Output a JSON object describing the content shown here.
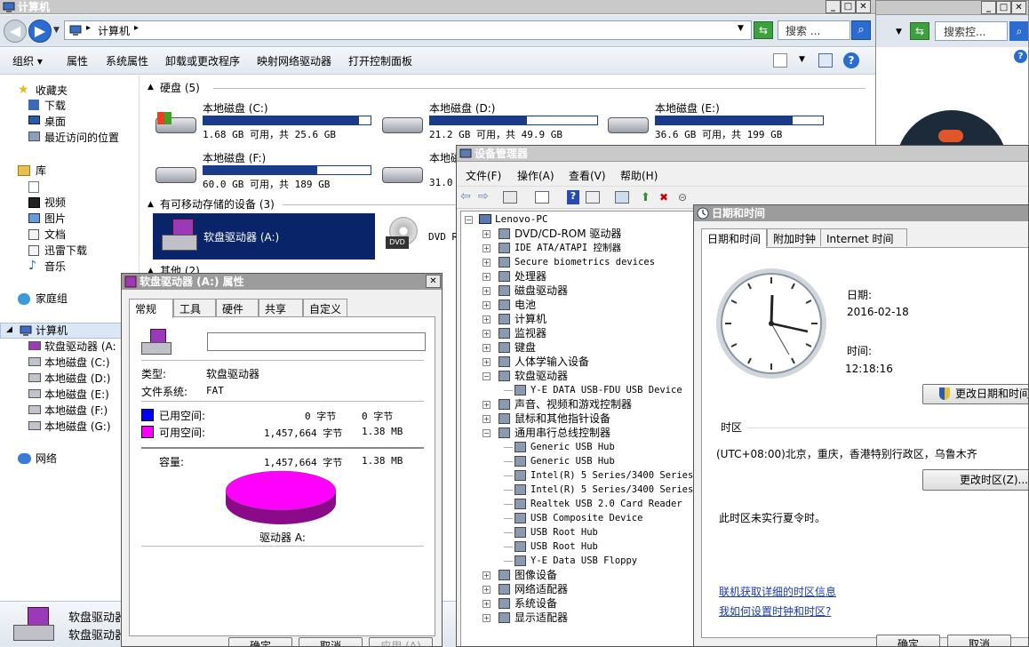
{
  "explorer": {
    "title": "计算机",
    "address_path": "计算机",
    "search_placeholder": "搜索 ...",
    "toolbar": [
      "组织 ▾",
      "属性",
      "系统属性",
      "卸载或更改程序",
      "映射网络驱动器",
      "打开控制面板"
    ],
    "nav": {
      "favorites": "收藏夹",
      "downloads": "下载",
      "desktop": "桌面",
      "recent": "最近访问的位置",
      "libraries": "库",
      "videos": "视频",
      "pictures": "图片",
      "documents": "文档",
      "xunlei": "迅雷下载",
      "music": "音乐",
      "homegroup": "家庭组",
      "computer": "计算机",
      "drives": [
        "软盘驱动器 (A:",
        "本地磁盘 (C:)",
        "本地磁盘 (D:)",
        "本地磁盘 (E:)",
        "本地磁盘 (F:)",
        "本地磁盘 (G:)"
      ],
      "network": "网络"
    },
    "hdd_group": "硬盘 (5)",
    "removable_group": "有可移动存储的设备 (3)",
    "other_group": "其他 (2)",
    "disks": [
      {
        "name": "本地磁盘 (C:)",
        "info": "1.68 GB 可用，共 25.6 GB",
        "used_pct": 93
      },
      {
        "name": "本地磁盘 (D:)",
        "info": "21.2 GB 可用，共 49.9 GB",
        "used_pct": 58
      },
      {
        "name": "本地磁盘 (E:)",
        "info": "36.6 GB 可用，共 199 GB",
        "used_pct": 82
      },
      {
        "name": "本地磁盘 (F:)",
        "info": "60.0 GB 可用，共 189 GB",
        "used_pct": 68
      },
      {
        "name": "本地磁",
        "info": "31.0",
        "used_pct": 0
      }
    ],
    "floppy": "软盘驱动器 (A:)",
    "dvd": "DVD R",
    "bottom_name1": "软盘驱动器",
    "bottom_name2": "软盘驱动器"
  },
  "right_window": {
    "search_placeholder": "搜索控..."
  },
  "properties": {
    "title": "软盘驱动器 (A:) 属性",
    "tabs": [
      "常规",
      "工具",
      "硬件",
      "共享",
      "自定义"
    ],
    "type_label": "类型:",
    "type_value": "软盘驱动器",
    "fs_label": "文件系统:",
    "fs_value": "FAT",
    "used_label": "已用空间:",
    "used_bytes": "0 字节",
    "used_size": "0 字节",
    "free_label": "可用空间:",
    "free_bytes": "1,457,664 字节",
    "free_size": "1.38 MB",
    "cap_label": "容量:",
    "cap_bytes": "1,457,664 字节",
    "cap_size": "1.38 MB",
    "drive_label": "驱动器 A:",
    "ok": "确定",
    "cancel": "取消",
    "apply": "应用 (A)",
    "colors": {
      "used": "#0000ff",
      "free": "#ff00ff"
    }
  },
  "devmgr": {
    "title": "设备管理器",
    "menu": [
      "文件(F)",
      "操作(A)",
      "查看(V)",
      "帮助(H)"
    ],
    "root": "Lenovo-PC",
    "items": [
      "DVD/CD-ROM 驱动器",
      "IDE ATA/ATAPI 控制器",
      "Secure biometrics devices",
      "处理器",
      "磁盘驱动器",
      "电池",
      "计算机",
      "监视器",
      "键盘",
      "人体学输入设备",
      "软盘驱动器",
      "Y-E DATA USB-FDU USB Device",
      "声音、视频和游戏控制器",
      "鼠标和其他指针设备",
      "通用串行总线控制器",
      "Generic USB Hub",
      "Generic USB Hub",
      "Intel(R) 5 Series/3400 Series",
      "Intel(R) 5 Series/3400 Series",
      "Realtek USB 2.0 Card Reader",
      "USB Composite Device",
      "USB Root Hub",
      "USB Root Hub",
      "Y-E Data USB Floppy",
      "图像设备",
      "网络适配器",
      "系统设备",
      "显示适配器"
    ]
  },
  "datetime": {
    "title": "日期和时间",
    "tabs": [
      "日期和时间",
      "附加时钟",
      "Internet 时间"
    ],
    "date_label": "日期:",
    "date": "2016-02-18",
    "time_label": "时间:",
    "time": "12:18:16",
    "change_dt": "更改日期和时间",
    "tz_label": "时区",
    "tz": "(UTC+08:00)北京，重庆，香港特别行政区，乌鲁木齐",
    "change_tz": "更改时区(Z)...",
    "dst": "此时区未实行夏令时。",
    "link1": "联机获取详细的时区信息",
    "link2": "我如何设置时钟和时区?",
    "ok": "确定",
    "cancel": "取消"
  }
}
